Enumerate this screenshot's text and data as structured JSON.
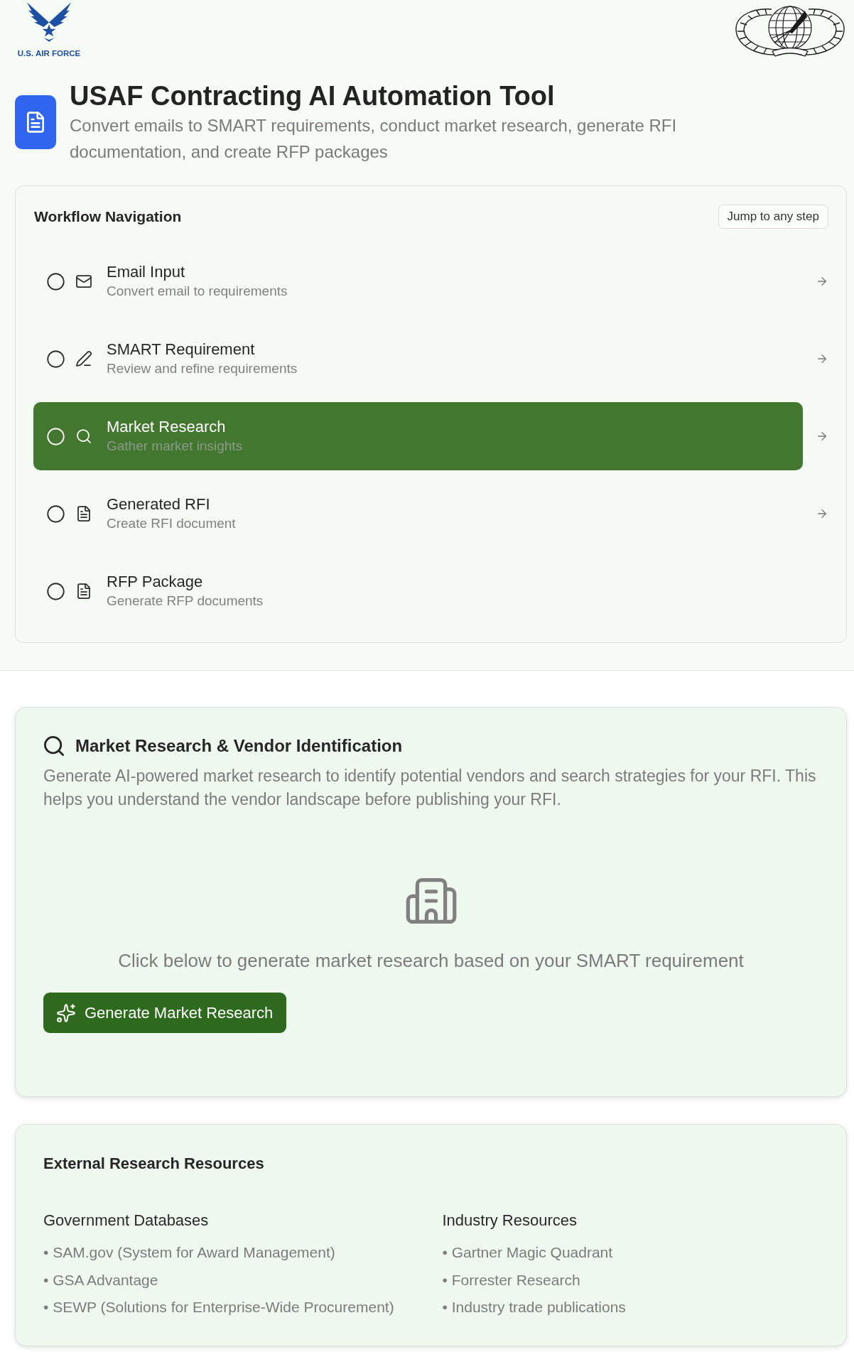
{
  "header": {
    "logo_text": "U.S. AIR FORCE",
    "title": "USAF Contracting AI Automation Tool",
    "subtitle": "Convert emails to SMART requirements, conduct market research, generate RFI documentation, and create RFP packages"
  },
  "workflow": {
    "title": "Workflow Navigation",
    "jump_badge": "Jump to any step",
    "steps": [
      {
        "kind": "email",
        "label": "Email Input",
        "description": "Convert email to requirements",
        "selected": false,
        "completed": false,
        "arrow": true
      },
      {
        "kind": "edit",
        "label": "SMART Requirement",
        "description": "Review and refine requirements",
        "selected": false,
        "completed": false,
        "arrow": true
      },
      {
        "kind": "search",
        "label": "Market Research",
        "description": "Gather market insights",
        "selected": true,
        "completed": false,
        "arrow": true
      },
      {
        "kind": "document",
        "label": "Generated RFI",
        "description": "Create RFI document",
        "selected": false,
        "completed": false,
        "arrow": true
      },
      {
        "kind": "document",
        "label": "RFP Package",
        "description": "Generate RFP documents",
        "selected": false,
        "completed": false,
        "arrow": false
      }
    ]
  },
  "market_research": {
    "title": "Market Research & Vendor Identification",
    "description": "Generate AI-powered market research to identify potential vendors and search strategies for your RFI. This helps you understand the vendor landscape before publishing your RFI.",
    "empty_state": {
      "message": "Click below to generate market research based on your SMART requirement"
    },
    "generate_button": "Generate Market Research"
  },
  "external_resources": {
    "title": "External Research Resources",
    "columns": [
      {
        "heading": "Government Databases",
        "items": [
          "• SAM.gov (System for Award Management)",
          "• GSA Advantage",
          "• SEWP (Solutions for Enterprise-Wide Procurement)"
        ]
      },
      {
        "heading": "Industry Resources",
        "items": [
          "• Gartner Magic Quadrant",
          "• Forrester Research",
          "• Industry trade publications"
        ]
      }
    ]
  }
}
